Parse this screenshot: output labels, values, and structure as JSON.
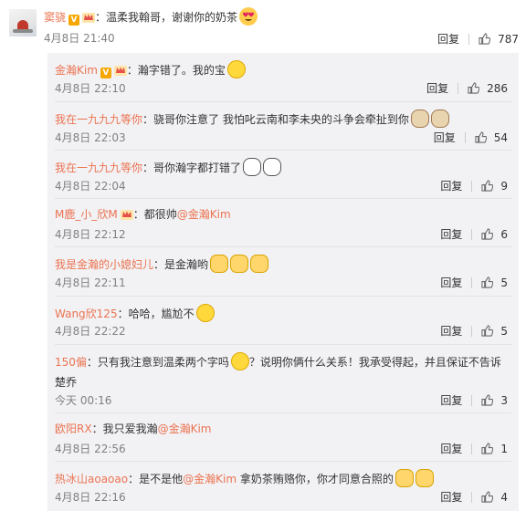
{
  "main": {
    "user": "窦骁",
    "text": "：温柔我翰哥，谢谢你的奶茶",
    "time": "4月8日 21:40",
    "reply_label": "回复",
    "likes": "787"
  },
  "replies": [
    {
      "user": "金瀚Kim",
      "text": "：瀚字错了。我的宝",
      "time": "4月8日 22:10",
      "likes": "286"
    },
    {
      "user": "我在一九九九等你",
      "text": "：骁哥你注意了 我怕叱云南和李未央的斗争会牵扯到你",
      "time": "4月8日 22:03",
      "likes": "54"
    },
    {
      "user": "我在一九九九等你",
      "text": "：哥你瀚字都打错了",
      "time": "4月8日 22:04",
      "likes": "9"
    },
    {
      "user": "M鹿_小_欣M",
      "text": "：都很帅",
      "mention": "@金瀚Kim",
      "time": "4月8日 22:12",
      "likes": "6"
    },
    {
      "user": "我是金瀚的小媳妇儿",
      "text": "：是金瀚哟",
      "time": "4月8日 22:11",
      "likes": "5"
    },
    {
      "user": "Wang欣125",
      "text": "：哈哈，尴尬不",
      "time": "4月8日 22:22",
      "likes": "5"
    },
    {
      "user": "150偏",
      "text": "：只有我注意到温柔两个字吗",
      "text2": "？说明你俩什么关系！我承受得起，并且保证不告诉",
      "text3": "楚乔",
      "time": "今天 00:16",
      "likes": "3"
    },
    {
      "user": "欧阳RX",
      "text": "：我只爱我瀚",
      "mention": "@金瀚Kim",
      "time": "4月8日 22:56",
      "likes": "1"
    },
    {
      "user": "热冰山aoaoao",
      "text": "：是不是他",
      "mention": "@金瀚Kim",
      "text_after": " 拿奶茶贿赂你，你才同意合照的",
      "time": "4月8日 22:16",
      "likes": "4"
    }
  ],
  "reply_label": "回复",
  "icons": {
    "like": "thumbs-up-icon",
    "verified": "verified-v-icon",
    "vip": "vip-crown-icon"
  },
  "colors": {
    "username": "#eb7350",
    "meta": "#808080",
    "panel": "#f2f2f5"
  }
}
